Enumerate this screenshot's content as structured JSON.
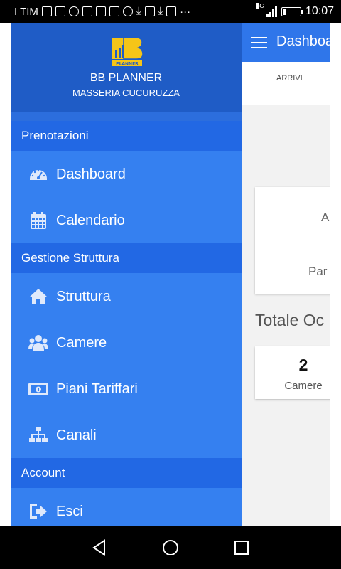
{
  "status_bar": {
    "carrier": "I TIM",
    "overflow": "···",
    "network": "4G",
    "time": "10:07"
  },
  "page": {
    "title": "Dashboard",
    "tab": "ARRIVI",
    "card_top_line1": "A",
    "card_top_line2": "Par",
    "section_title": "Totale Oc",
    "rooms_count": "2",
    "rooms_label": "Camere"
  },
  "drawer": {
    "app_name": "BB PLANNER",
    "property_name": "MASSERIA CUCURUZZA",
    "logo_text": "PLANNER",
    "sections": [
      {
        "title": "Prenotazioni"
      },
      {
        "title": "Gestione Struttura"
      },
      {
        "title": "Account"
      }
    ],
    "items": [
      {
        "label": "Dashboard",
        "icon": "dashboard-icon"
      },
      {
        "label": "Calendario",
        "icon": "calendar-icon"
      },
      {
        "label": "Struttura",
        "icon": "home-icon"
      },
      {
        "label": "Camere",
        "icon": "users-icon"
      },
      {
        "label": "Piani Tariffari",
        "icon": "money-icon"
      },
      {
        "label": "Canali",
        "icon": "sitemap-icon"
      },
      {
        "label": "Esci",
        "icon": "sign-out-icon"
      }
    ]
  },
  "colors": {
    "drawer_bg": "#3580f0",
    "drawer_header": "#1f5cc6",
    "section_bg": "#2268e4",
    "app_bar": "#2f76ea",
    "logo_yellow": "#f5c518"
  }
}
